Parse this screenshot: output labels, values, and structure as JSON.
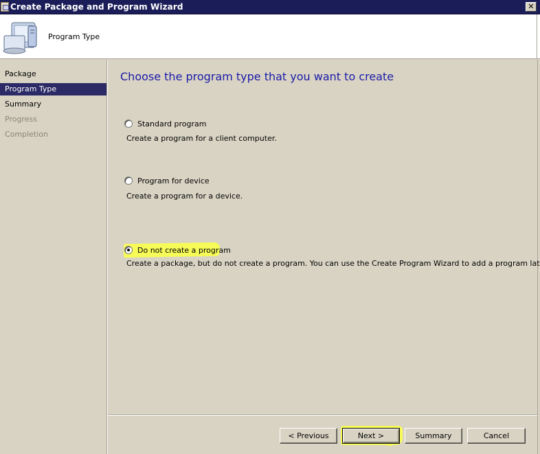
{
  "window": {
    "title": "Create Package and Program Wizard",
    "close_label": "✕"
  },
  "header": {
    "title": "Program Type"
  },
  "sidebar": {
    "items": [
      {
        "label": "Package",
        "state": "normal"
      },
      {
        "label": "Program Type",
        "state": "active"
      },
      {
        "label": "Summary",
        "state": "normal"
      },
      {
        "label": "Progress",
        "state": "disabled"
      },
      {
        "label": "Completion",
        "state": "disabled"
      }
    ]
  },
  "main": {
    "heading": "Choose the program type that you want to create",
    "options": [
      {
        "label": "Standard program",
        "description": "Create a program for a client computer.",
        "checked": false
      },
      {
        "label": "Program for device",
        "description": "Create a program for a device.",
        "checked": false
      },
      {
        "label": "Do not create a program",
        "description": "Create a package, but do not create a program. You can use the Create Program Wizard to add a program later.",
        "checked": true
      }
    ]
  },
  "buttons": {
    "previous": "< Previous",
    "next": "Next >",
    "summary": "Summary",
    "cancel": "Cancel"
  },
  "colors": {
    "titlebar": "#1b1d58",
    "active_nav": "#2b2a66",
    "heading_text": "#1a1aa8",
    "dialog_bg": "#d8d3c3",
    "highlight": "#f6fb58"
  },
  "icons": {
    "window": "package-icon",
    "header": "computer-package-icon"
  }
}
